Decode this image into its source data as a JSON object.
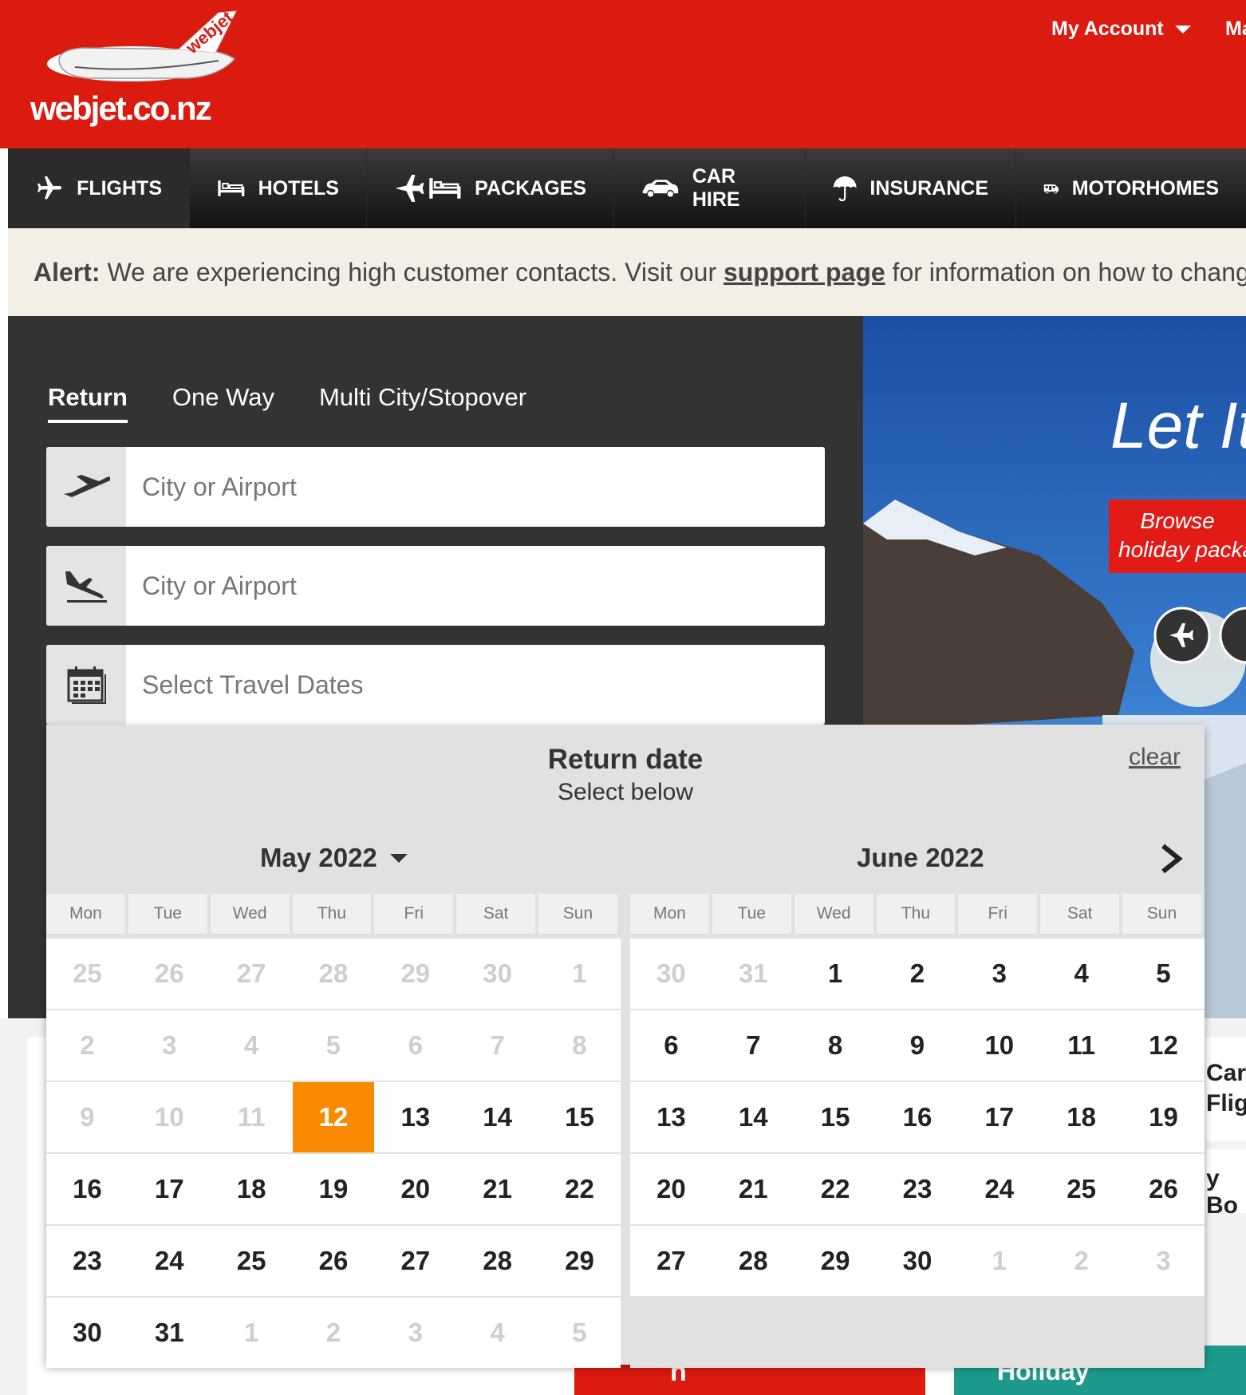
{
  "header": {
    "logo_text": "webjet.co.nz",
    "logo_tail": "webjet",
    "my_account": "My Account",
    "next_menu": "Ma"
  },
  "nav": {
    "items": [
      {
        "label": "FLIGHTS",
        "icon": "plane-icon"
      },
      {
        "label": "HOTELS",
        "icon": "bed-icon"
      },
      {
        "label": "PACKAGES",
        "icon": "plane-bed-icon"
      },
      {
        "label": "CAR HIRE",
        "icon": "car-icon"
      },
      {
        "label": "INSURANCE",
        "icon": "umbrella-icon"
      },
      {
        "label": "MOTORHOMES",
        "icon": "motorhome-icon"
      }
    ]
  },
  "alert": {
    "prefix": "Alert:",
    "text1": " We are experiencing high customer contacts. Visit our ",
    "link": "support page",
    "text2": " for information on how to chang"
  },
  "search": {
    "tabs": [
      "Return",
      "One Way",
      "Multi City/Stopover"
    ],
    "from_placeholder": "City or Airport",
    "to_placeholder": "City or Airport",
    "dates_placeholder": "Select Travel Dates"
  },
  "hero": {
    "headline": "Let It",
    "line1": "Browse",
    "line2": "holiday packa"
  },
  "below": {
    "side1": "Car",
    "side2": "Flig",
    "side3": "y Bo",
    "card_a": "h",
    "card_b": "Holiday"
  },
  "calendar": {
    "title": "Return date",
    "subtitle": "Select below",
    "clear": "clear",
    "weekdays": [
      "Mon",
      "Tue",
      "Wed",
      "Thu",
      "Fri",
      "Sat",
      "Sun"
    ],
    "months": [
      {
        "label": "May 2022",
        "weeks": [
          [
            "25",
            "26",
            "27",
            "28",
            "29",
            "30",
            "1"
          ],
          [
            "2",
            "3",
            "4",
            "5",
            "6",
            "7",
            "8"
          ],
          [
            "9",
            "10",
            "11",
            "12",
            "13",
            "14",
            "15"
          ],
          [
            "16",
            "17",
            "18",
            "19",
            "20",
            "21",
            "22"
          ],
          [
            "23",
            "24",
            "25",
            "26",
            "27",
            "28",
            "29"
          ],
          [
            "30",
            "31",
            "1",
            "2",
            "3",
            "4",
            "5"
          ]
        ],
        "off": [
          [
            0,
            1,
            2,
            3,
            4,
            5,
            6
          ],
          [
            0,
            1,
            2,
            3,
            4,
            5,
            6
          ],
          [
            0,
            1,
            2
          ],
          [],
          [],
          [
            2,
            3,
            4,
            5,
            6
          ]
        ],
        "selected": [
          2,
          3
        ]
      },
      {
        "label": "June 2022",
        "weeks": [
          [
            "30",
            "31",
            "1",
            "2",
            "3",
            "4",
            "5"
          ],
          [
            "6",
            "7",
            "8",
            "9",
            "10",
            "11",
            "12"
          ],
          [
            "13",
            "14",
            "15",
            "16",
            "17",
            "18",
            "19"
          ],
          [
            "20",
            "21",
            "22",
            "23",
            "24",
            "25",
            "26"
          ],
          [
            "27",
            "28",
            "29",
            "30",
            "1",
            "2",
            "3"
          ]
        ],
        "off": [
          [
            0,
            1
          ],
          [],
          [],
          [],
          [
            4,
            5,
            6
          ]
        ],
        "selected": null
      }
    ]
  },
  "colors": {
    "brand_red": "#db1a10",
    "selected_orange": "#f98a00"
  }
}
